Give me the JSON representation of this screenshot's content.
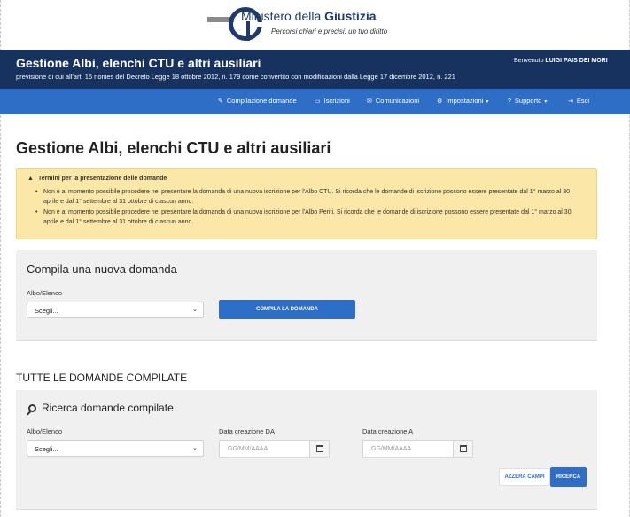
{
  "logo": {
    "name_prefix": "Ministero della ",
    "name_bold": "Giustizia",
    "tagline": "Percorsi chiari e precisi: un tuo diritto"
  },
  "header": {
    "title": "Gestione Albi, elenchi CTU e altri ausiliari",
    "subtitle": "previsione di cui all'art. 16 nonies del Decreto Legge 18 ottobre 2012, n. 179 come convertito con modificazioni dalla Legge 17 dicembre 2012, n. 221",
    "welcome_prefix": "Benvenuto ",
    "user_name": "LUIGI PAIS DEI MORI"
  },
  "nav": {
    "items": [
      {
        "label": "Compilazione domande",
        "icon": "edit-icon"
      },
      {
        "label": "Iscrizioni",
        "icon": "id-card-icon"
      },
      {
        "label": "Comunicazioni",
        "icon": "envelope-icon"
      },
      {
        "label": "Impostazioni",
        "icon": "gear-icon",
        "dropdown": true
      },
      {
        "label": "Supporto",
        "icon": "question-icon",
        "dropdown": true
      },
      {
        "label": "Esci",
        "icon": "logout-icon"
      }
    ]
  },
  "page_title": "Gestione Albi, elenchi CTU e altri ausiliari",
  "alert": {
    "title": "Termini per la presentazione delle domande",
    "items": [
      "Non è al momento possibile procedere nel presentare la domanda di una nuova iscrizione per l'Albo CTU. Si ricorda che le domande di iscrizione possono essere presentate dal 1° marzo al 30 aprile e dal 1° settembre al 31 ottobre di ciascun anno.",
      "Non è al momento possibile procedere nel presentare la domanda di una nuova iscrizione per l'Albo Periti. Si ricorda che le domande di iscrizione possono essere presentate dal 1° marzo al 30 aprile e dal 1° settembre al 31 ottobre di ciascun anno."
    ]
  },
  "compila": {
    "title": "Compila una nuova domanda",
    "albo_label": "Albo/Elenco",
    "albo_value": "Scegli...",
    "button": "COMPILA LA DOMANDA"
  },
  "tutte": {
    "section_title": "TUTTE LE DOMANDE COMPILATE",
    "search_title": "Ricerca domande compilate",
    "albo_label": "Albo/Elenco",
    "albo_value": "Scegli...",
    "date_from_label": "Data creazione DA",
    "date_from_placeholder": "GG/MM/AAAA",
    "date_to_label": "Data creazione A",
    "date_to_placeholder": "GG/MM/AAAA",
    "reset_button": "AZZERA CAMPI",
    "search_button": "RICERCA"
  },
  "colors": {
    "header_bg": "#17325e",
    "nav_bg": "#2f6ec7",
    "alert_bg": "#fbe8a8",
    "panel_bg": "#f0f0f0"
  }
}
